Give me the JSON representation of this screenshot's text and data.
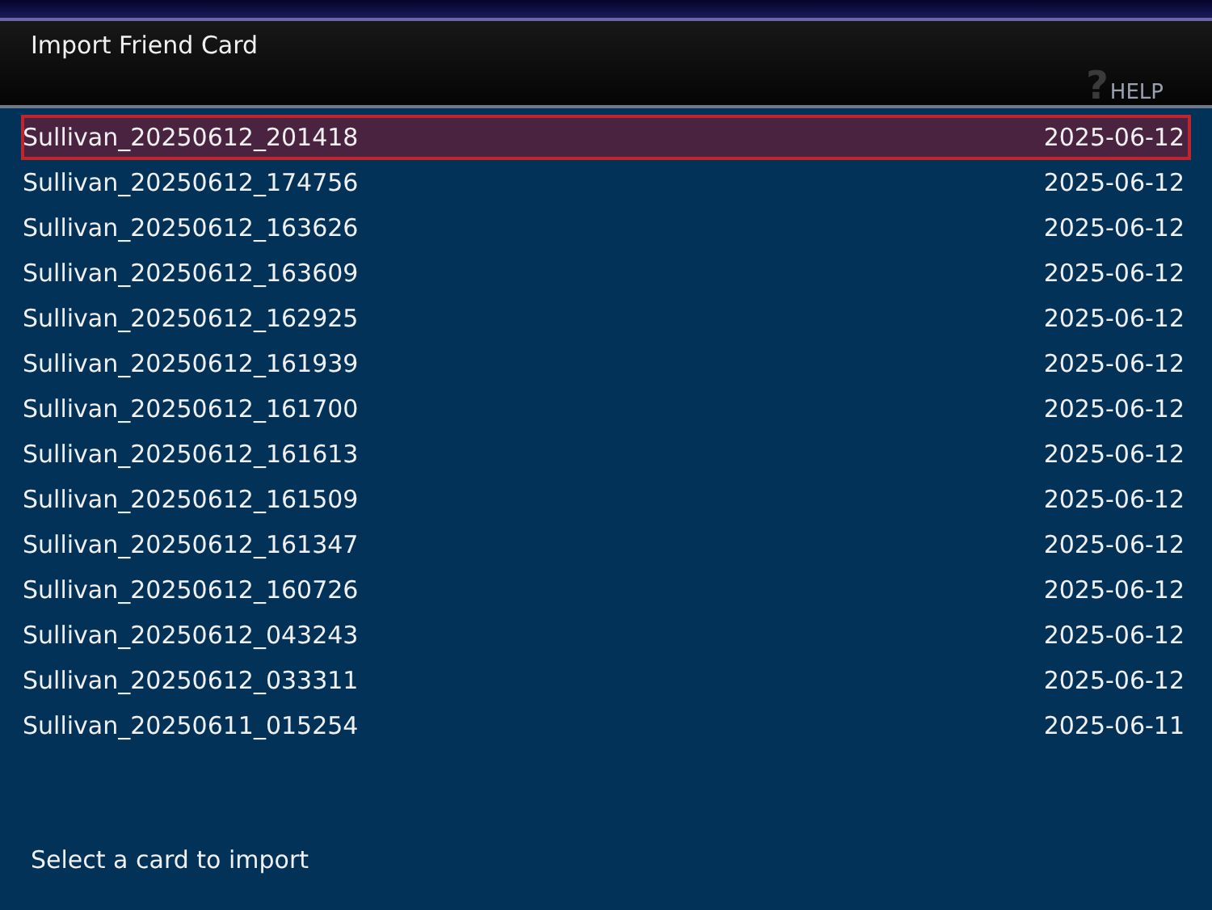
{
  "window": {
    "title": "Import Friend Card"
  },
  "help": {
    "icon": "?",
    "label": "HELP"
  },
  "files": [
    {
      "name": "Sullivan_20250612_201418",
      "date": "2025-06-12",
      "selected": true
    },
    {
      "name": "Sullivan_20250612_174756",
      "date": "2025-06-12",
      "selected": false
    },
    {
      "name": "Sullivan_20250612_163626",
      "date": "2025-06-12",
      "selected": false
    },
    {
      "name": "Sullivan_20250612_163609",
      "date": "2025-06-12",
      "selected": false
    },
    {
      "name": "Sullivan_20250612_162925",
      "date": "2025-06-12",
      "selected": false
    },
    {
      "name": "Sullivan_20250612_161939",
      "date": "2025-06-12",
      "selected": false
    },
    {
      "name": "Sullivan_20250612_161700",
      "date": "2025-06-12",
      "selected": false
    },
    {
      "name": "Sullivan_20250612_161613",
      "date": "2025-06-12",
      "selected": false
    },
    {
      "name": "Sullivan_20250612_161509",
      "date": "2025-06-12",
      "selected": false
    },
    {
      "name": "Sullivan_20250612_161347",
      "date": "2025-06-12",
      "selected": false
    },
    {
      "name": "Sullivan_20250612_160726",
      "date": "2025-06-12",
      "selected": false
    },
    {
      "name": "Sullivan_20250612_043243",
      "date": "2025-06-12",
      "selected": false
    },
    {
      "name": "Sullivan_20250612_033311",
      "date": "2025-06-12",
      "selected": false
    },
    {
      "name": "Sullivan_20250611_015254",
      "date": "2025-06-11",
      "selected": false
    }
  ],
  "status_bar": {
    "hint": "Select a card to import"
  }
}
